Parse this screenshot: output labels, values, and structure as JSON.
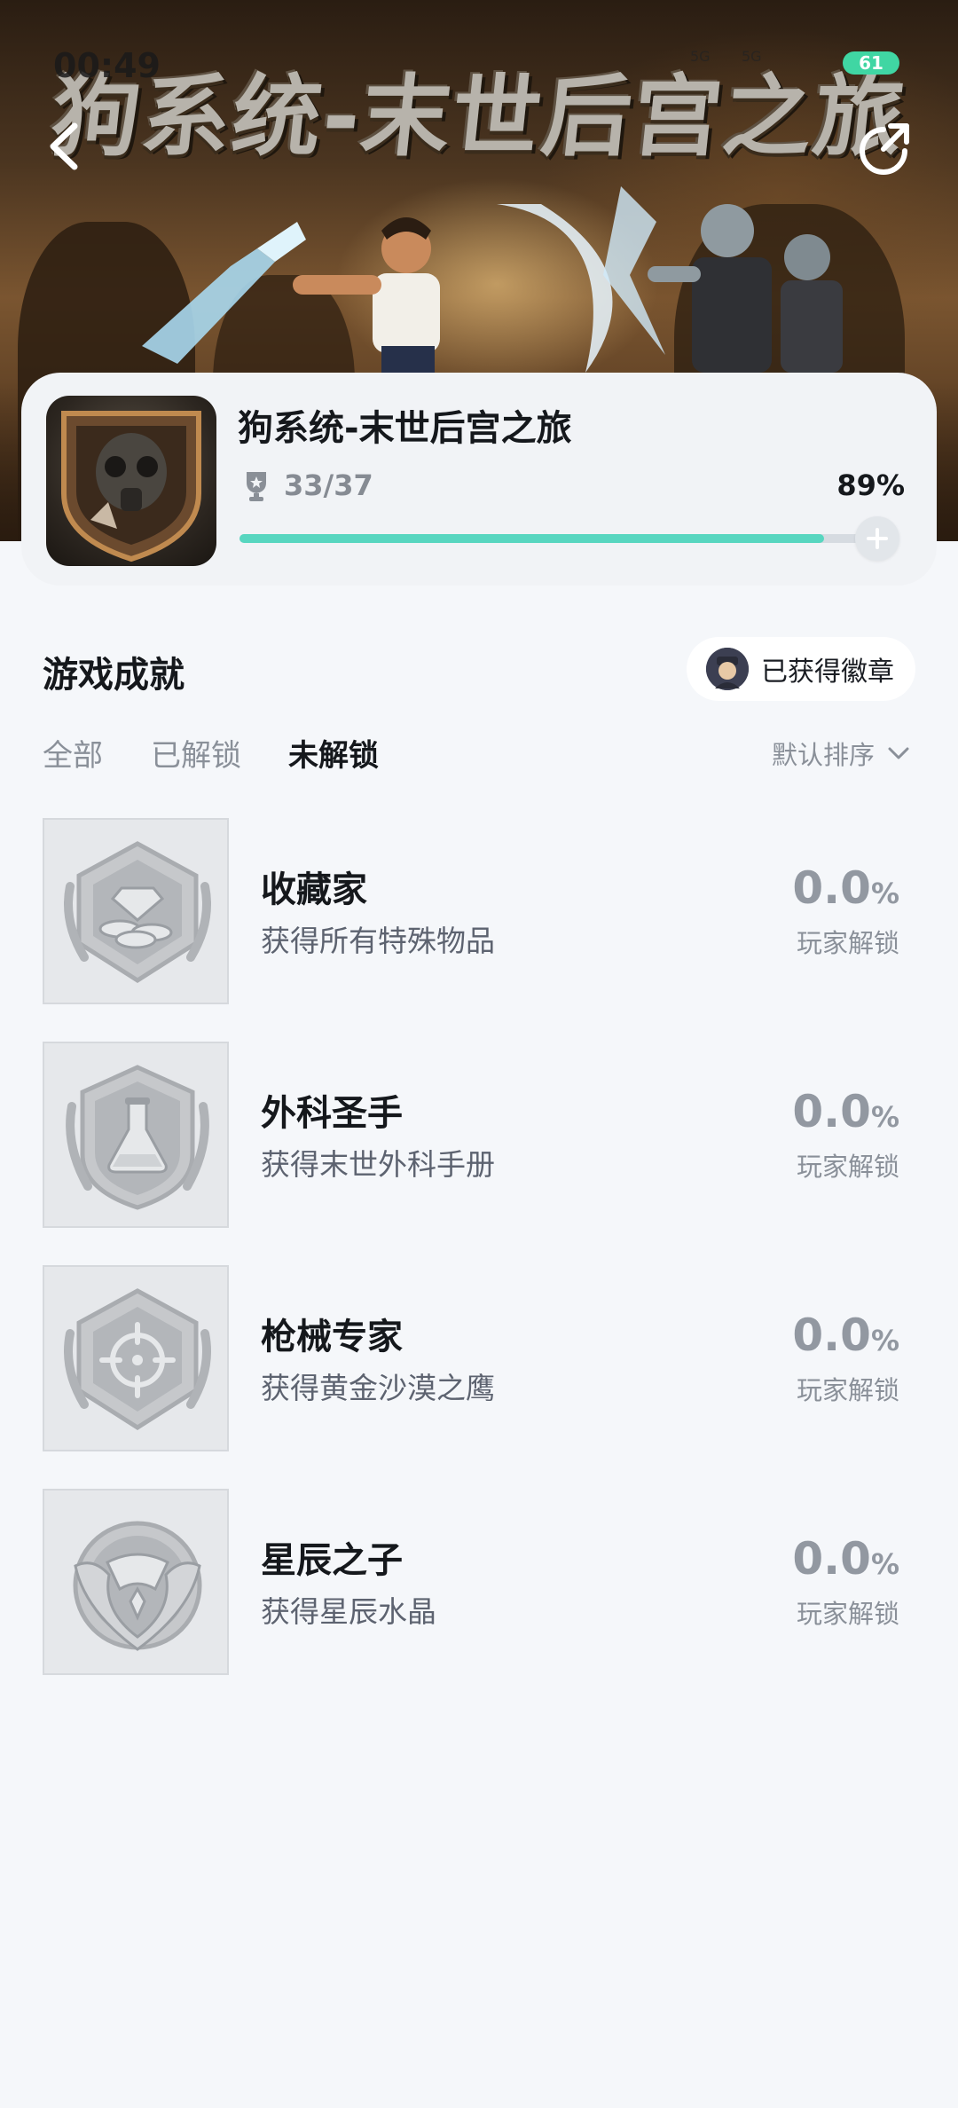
{
  "status_bar": {
    "time": "00:49",
    "network_labels": [
      "5G",
      "5G"
    ],
    "battery": "61"
  },
  "hero": {
    "banner_title": "狗系统-末世后宫之旅"
  },
  "game": {
    "name": "狗系统-末世后宫之旅",
    "progress_text": "33/37",
    "progress_percent_text": "89%",
    "progress_fraction": 0.89
  },
  "achievements_section": {
    "title": "游戏成就",
    "badge_button_label": "已获得徽章"
  },
  "tabs": [
    {
      "label": "全部",
      "active": false
    },
    {
      "label": "已解锁",
      "active": false
    },
    {
      "label": "未解锁",
      "active": true
    }
  ],
  "sort": {
    "label": "默认排序"
  },
  "achievements": [
    {
      "name": "收藏家",
      "desc": "获得所有特殊物品",
      "rate_value": "0.0",
      "rate_unit": "%",
      "rate_label": "玩家解锁",
      "icon": "gems-coins-icon"
    },
    {
      "name": "外科圣手",
      "desc": "获得末世外科手册",
      "rate_value": "0.0",
      "rate_unit": "%",
      "rate_label": "玩家解锁",
      "icon": "flask-icon"
    },
    {
      "name": "枪械专家",
      "desc": "获得黄金沙漠之鹰",
      "rate_value": "0.0",
      "rate_unit": "%",
      "rate_label": "玩家解锁",
      "icon": "crosshair-icon"
    },
    {
      "name": "星辰之子",
      "desc": "获得星辰水晶",
      "rate_value": "0.0",
      "rate_unit": "%",
      "rate_label": "玩家解锁",
      "icon": "owl-icon"
    }
  ],
  "colors": {
    "accent": "#58d6c0",
    "background": "#f5f7fa",
    "battery": "#40d6a3"
  }
}
